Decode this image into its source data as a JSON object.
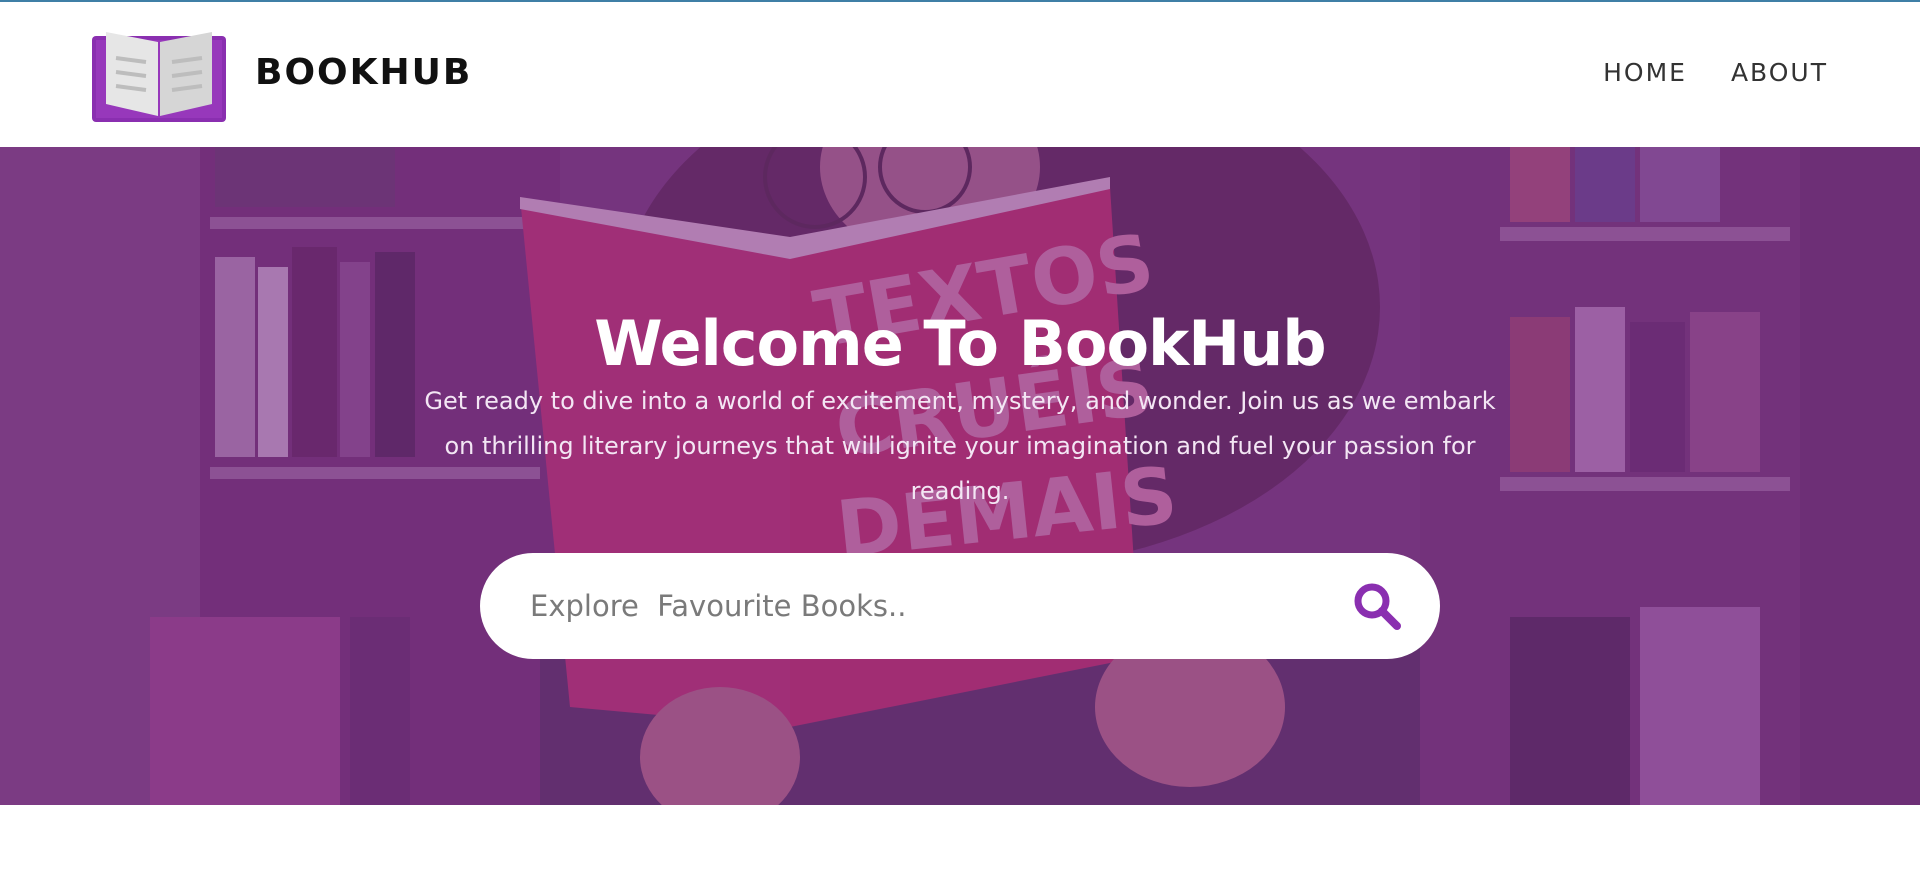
{
  "header": {
    "brand": "BOOKHUB",
    "nav": [
      {
        "label": "HOME"
      },
      {
        "label": "ABOUT"
      }
    ]
  },
  "hero": {
    "title": "Welcome To BookHub",
    "subtitle": "Get ready to dive into a world of excitement, mystery, and wonder. Join us as we embark on thrilling literary journeys that will ignite your imagination and fuel your passion for reading.",
    "search": {
      "placeholder": "Explore  Favourite Books..",
      "value": ""
    }
  },
  "colors": {
    "accent": "#8a2fb0",
    "overlay": "#7a2f86",
    "book_red": "#d9234f",
    "top_line": "#3f7fa6"
  },
  "icons": {
    "logo": "open-book-icon",
    "search": "search-icon"
  }
}
